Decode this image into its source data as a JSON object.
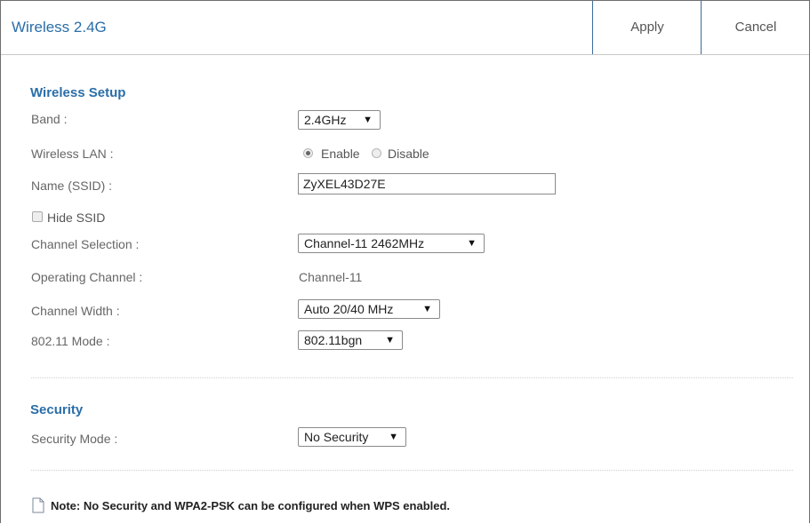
{
  "header": {
    "title": "Wireless 2.4G",
    "apply_label": "Apply",
    "cancel_label": "Cancel"
  },
  "wireless_setup": {
    "section_title": "Wireless Setup",
    "band": {
      "label": "Band :",
      "value": "2.4GHz"
    },
    "wireless_lan": {
      "label": "Wireless LAN :",
      "enable_label": "Enable",
      "disable_label": "Disable",
      "selected": "Enable"
    },
    "ssid": {
      "label": "Name (SSID) :",
      "value": "ZyXEL43D27E"
    },
    "hide_ssid": {
      "label": "Hide SSID",
      "checked": false
    },
    "channel_selection": {
      "label": "Channel Selection :",
      "value": "Channel-11 2462MHz"
    },
    "operating_channel": {
      "label": "Operating Channel :",
      "value": "Channel-11"
    },
    "channel_width": {
      "label": "Channel Width :",
      "value": "Auto 20/40 MHz"
    },
    "mode": {
      "label": "802.11 Mode :",
      "value": "802.11bgn"
    }
  },
  "security": {
    "section_title": "Security",
    "mode": {
      "label": "Security Mode :",
      "value": "No Security"
    }
  },
  "note": "Note: No Security and WPA2-PSK can be configured when WPS enabled.",
  "colors": {
    "accent": "#2a6ea8",
    "border": "#3b6b98"
  }
}
